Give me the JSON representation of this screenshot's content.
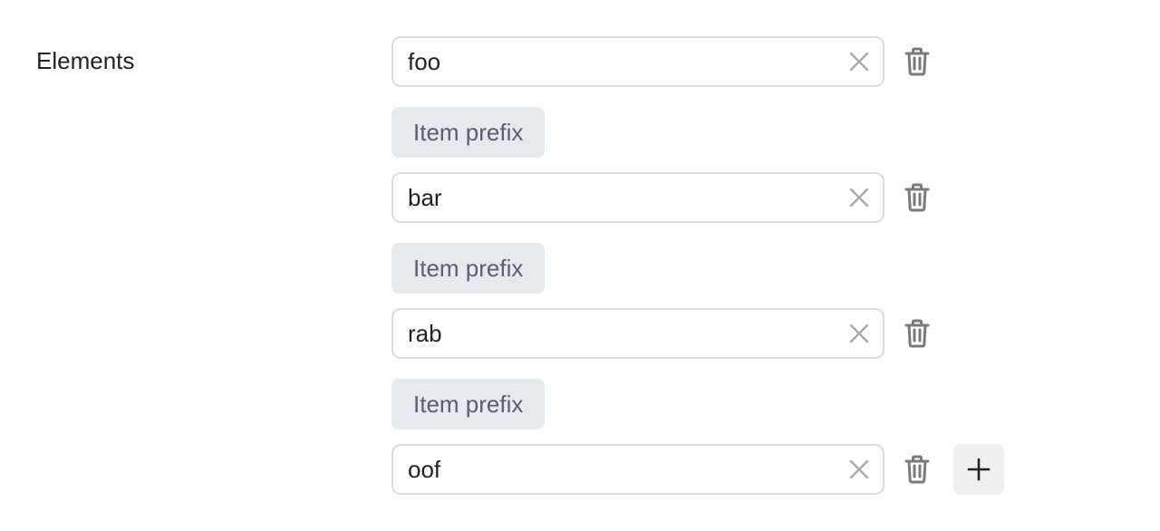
{
  "field": {
    "label": "Elements"
  },
  "items": [
    {
      "value": "foo",
      "prefix": "Item prefix"
    },
    {
      "value": "bar",
      "prefix": "Item prefix"
    },
    {
      "value": "rab",
      "prefix": "Item prefix"
    },
    {
      "value": "oof"
    }
  ],
  "icons": {
    "clear": "close-icon",
    "delete": "trash-icon",
    "add": "plus-icon"
  },
  "colors": {
    "input_border": "#dcdcdc",
    "chip_bg": "#e7eaed",
    "chip_text": "#556070",
    "icon_gray": "#7a7a7a",
    "clear_gray": "#aaaaaa",
    "add_bg": "#efefef"
  }
}
